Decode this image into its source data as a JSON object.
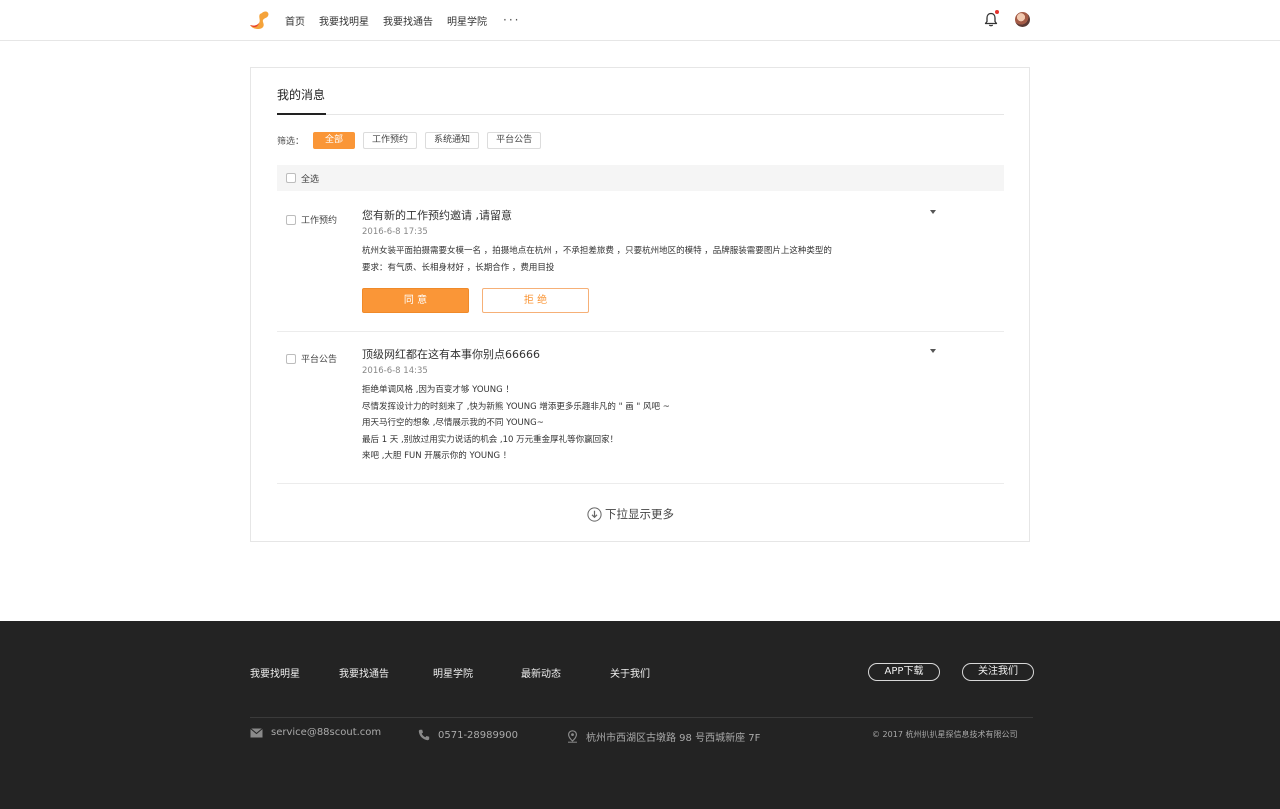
{
  "header": {
    "nav": [
      "首页",
      "我要找明星",
      "我要找通告",
      "明星学院"
    ],
    "more": "···",
    "accent": "#fa9637",
    "notification_dot": "#e5322d"
  },
  "main": {
    "title": "我的消息",
    "filter_label": "筛选：",
    "filters": [
      "全部",
      "工作预约",
      "系统通知",
      "平台公告"
    ],
    "active_filter": "全部",
    "select_all": "全选",
    "messages": [
      {
        "type": "工作预约",
        "title": "您有新的工作预约邀请 ,请留意",
        "time": "2016-6-8  17:35",
        "lines": [
          "杭州女装平面拍摄需要女模一名 ，拍摄地点在杭州 ，不承担差旅费 ，只要杭州地区的模特 ，品牌服装需要图片上这种类型的",
          "要求：有气质、长相身材好 ，长期合作 ，费用目投"
        ],
        "accept": "同 意",
        "reject": "拒 绝"
      },
      {
        "type": "平台公告",
        "title": "顶级网红都在这有本事你别点66666",
        "time": "2016-6-8 14:35",
        "lines": [
          "拒绝单调风格 ,因为百变才够 YOUNG ！",
          "尽情发挥设计力的时刻来了 ,快为新熊 YOUNG 增添更多乐趣非凡的 \" 画 \" 风吧 ~",
          "用天马行空的想象 ,尽情展示我的不同 YOUNG~",
          "最后 1 天 ,别放过用实力说话的机会 ,10 万元重金厚礼等你赢回家！",
          "来吧 ,大胆 FUN 开展示你的 YOUNG ！"
        ]
      }
    ],
    "load_more": "下拉显示更多"
  },
  "footer": {
    "links": [
      "我要找明星",
      "我要找通告",
      "明星学院",
      "最新动态",
      "关于我们"
    ],
    "app_download": "APP下载",
    "follow_us": "关注我们",
    "email": "service@88scout.com",
    "phone": "0571-28989900",
    "address": "杭州市西湖区古墩路 98 号西城新座 7F",
    "copyright": "© 2017  杭州扒扒星探信息技术有限公司"
  }
}
